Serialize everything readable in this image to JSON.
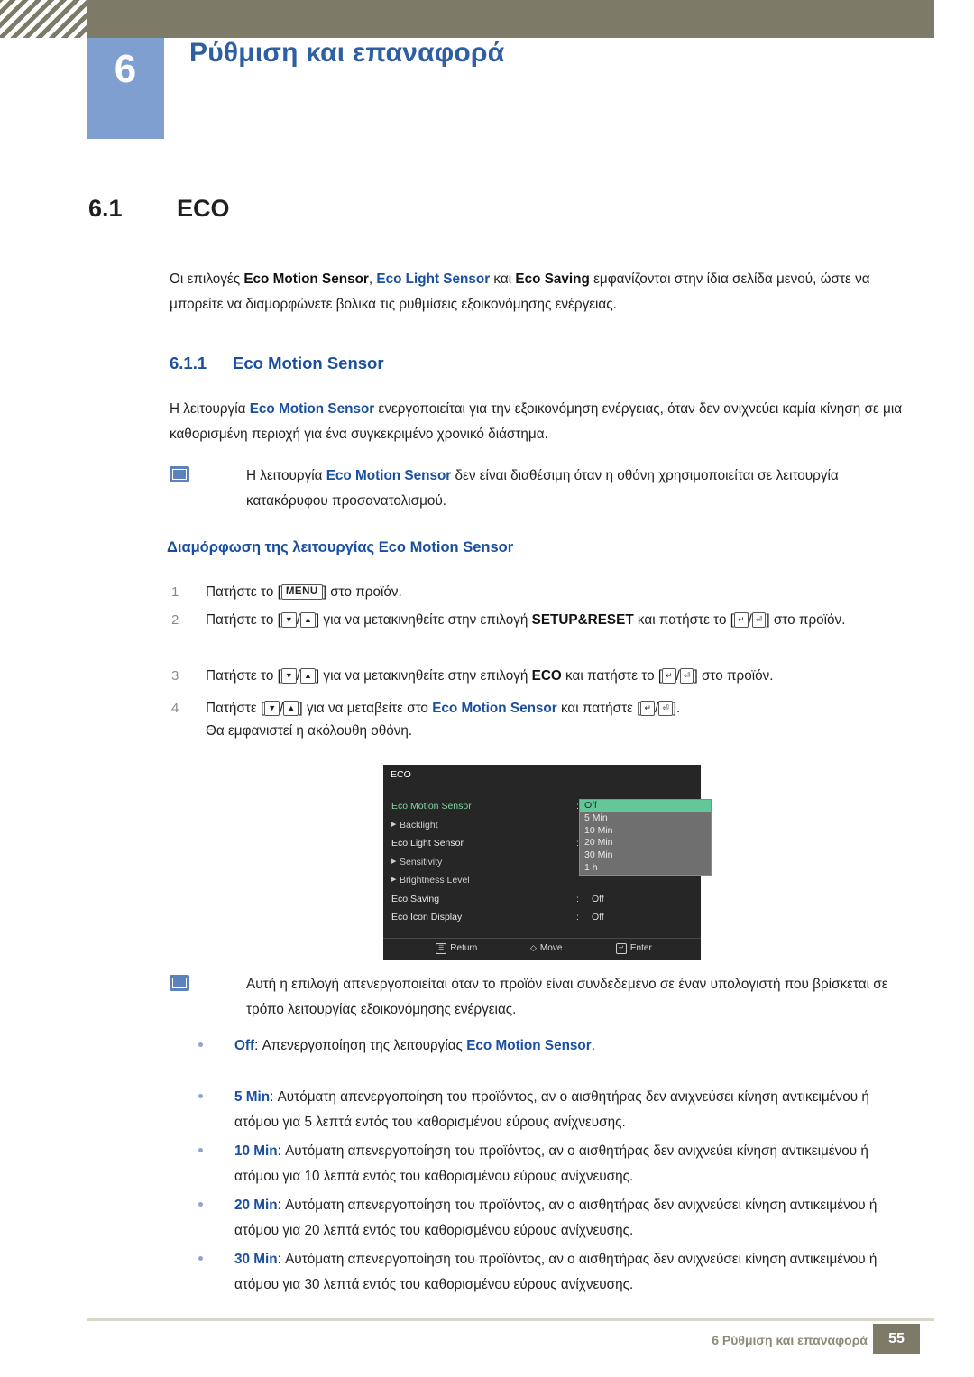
{
  "header": {
    "chapter_number": "6",
    "chapter_title": "Ρύθμιση και επαναφορά"
  },
  "section": {
    "number": "6.1",
    "title": "ECO"
  },
  "intro": {
    "before1": "Οι επιλογές ",
    "b1": "Eco Motion Sensor",
    "mid1": ", ",
    "b2": "Eco Light Sensor",
    "mid2": " και ",
    "b3": "Eco Saving",
    "after": " εμφανίζονται στην ίδια σελίδα μενού, ώστε να μπορείτε να διαμορφώνετε βολικά τις ρυθμίσεις εξοικονόμησης ενέργειας."
  },
  "subsection": {
    "number": "6.1.1",
    "title": "Eco Motion Sensor"
  },
  "para2": {
    "before": "Η λειτουργία ",
    "bold": "Eco Motion Sensor",
    "after": " ενεργοποιείται για την εξοικονόμηση ενέργειας, όταν δεν ανιχνεύει καμία κίνηση σε μια καθορισμένη περιοχή για ένα συγκεκριμένο χρονικό διάστημα."
  },
  "note1": {
    "before": "Η λειτουργία ",
    "bold": "Eco Motion Sensor",
    "after": " δεν είναι διαθέσιμη όταν η οθόνη χρησιμοποιείται σε λειτουργία κατακόρυφου προσανατολισμού."
  },
  "config_heading": "Διαμόρφωση της λειτουργίας Eco Motion Sensor",
  "steps": [
    {
      "n": "1",
      "p1": "Πατήστε το [",
      "key": "MENU",
      "p2": "] στο προϊόν."
    },
    {
      "n": "2",
      "p1": "Πατήστε το [",
      "k1": "▼",
      "sl": "/",
      "k2": "▲",
      "p2": "] για να μετακινηθείτε στην επιλογή ",
      "b": "SETUP&RESET",
      "p3": " και πατήστε το [",
      "k3": "↵",
      "sl2": "/",
      "k4": "⏎",
      "p4": "] στο προϊόν."
    },
    {
      "n": "3",
      "p1": "Πατήστε το [",
      "k1": "▼",
      "sl": "/",
      "k2": "▲",
      "p2": "] για να μετακινηθείτε στην επιλογή ",
      "b": "ECO",
      "p3": " και πατήστε το [",
      "k3": "↵",
      "sl2": "/",
      "k4": "⏎",
      "p4": "] στο προϊόν."
    },
    {
      "n": "4",
      "p1": "Πατήστε [",
      "k1": "▼",
      "sl": "/",
      "k2": "▲",
      "p2": "] για να μεταβείτε στο ",
      "b": "Eco Motion Sensor",
      "p3": " και πατήστε [",
      "k3": "↵",
      "sl2": "/",
      "k4": "⏎",
      "p4": "]."
    }
  ],
  "step4_followup": "Θα εμφανιστεί η ακόλουθη οθόνη.",
  "osd": {
    "title": "ECO",
    "rows": [
      {
        "label": "Eco Motion Sensor",
        "highlight": true,
        "colon": ":",
        "value": ""
      },
      {
        "label": "Backlight",
        "sub": true
      },
      {
        "label": "Eco Light Sensor",
        "colon": ":",
        "value": ""
      },
      {
        "label": "Sensitivity",
        "sub": true
      },
      {
        "label": "Brightness Level",
        "sub": true
      },
      {
        "label": "Eco Saving",
        "colon": ":",
        "value": "Off"
      },
      {
        "label": "Eco Icon Display",
        "colon": ":",
        "value": "Off"
      }
    ],
    "dropdown": [
      {
        "label": "Off",
        "selected": true
      },
      {
        "label": "5 Min",
        "selected": false
      },
      {
        "label": "10 Min",
        "selected": false
      },
      {
        "label": "20 Min",
        "selected": false
      },
      {
        "label": "30 Min",
        "selected": false
      },
      {
        "label": "1 h",
        "selected": false
      }
    ],
    "footer": {
      "return": "Return",
      "move": "Move",
      "enter": "Enter"
    }
  },
  "note2": "Αυτή η επιλογή απενεργοποιείται όταν το προϊόν είναι συνδεδεμένο σε έναν υπολογιστή που βρίσκεται σε τρόπο λειτουργίας εξοικονόμησης ενέργειας.",
  "bullets": [
    {
      "key": "Off",
      "text": ": Απενεργοποίηση της λειτουργίας ",
      "bold_tail": "Eco Motion Sensor",
      "tail": "."
    },
    {
      "key": "5 Min",
      "text": ": Αυτόματη απενεργοποίηση του προϊόντος, αν ο αισθητήρας δεν ανιχνεύσει κίνηση αντικειμένου ή ατόμου για 5 λεπτά εντός του καθορισμένου εύρους ανίχνευσης."
    },
    {
      "key": "10 Min",
      "text": ": Αυτόματη απενεργοποίηση του προϊόντος, αν ο αισθητήρας δεν ανιχνεύει κίνηση αντικειμένου ή ατόμου για 10 λεπτά εντός του καθορισμένου εύρους ανίχνευσης."
    },
    {
      "key": "20 Min",
      "text": ": Αυτόματη απενεργοποίηση του προϊόντος, αν ο αισθητήρας δεν ανιχνεύσει κίνηση αντικειμένου ή ατόμου για 20 λεπτά εντός του καθορισμένου εύρους ανίχνευσης."
    },
    {
      "key": "30 Min",
      "text": ": Αυτόματη απενεργοποίηση του προϊόντος, αν ο αισθητήρας δεν ανιχνεύσει κίνηση αντικειμένου ή ατόμου για 30 λεπτά εντός του καθορισμένου εύρους ανίχνευσης."
    }
  ],
  "footer": {
    "text": "6 Ρύθμιση και επαναφορά",
    "page": "55"
  },
  "colors": {
    "accent_blue": "#1a4fa0",
    "chapter_block": "#7e9fd0",
    "header_bar": "#7d7a68",
    "osd_highlight": "#63c79a"
  }
}
